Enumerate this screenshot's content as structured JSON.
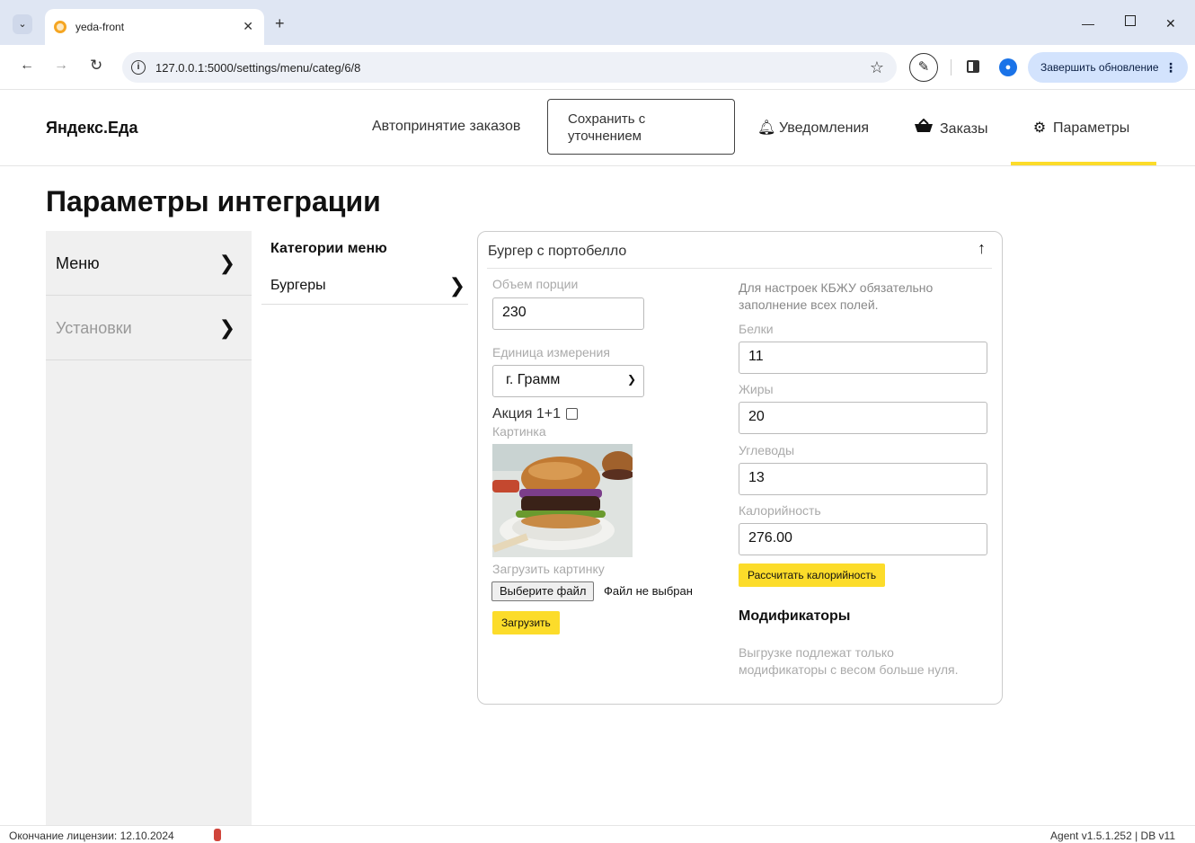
{
  "browser": {
    "tab_title": "yeda-front",
    "url": "127.0.0.1:5000/settings/menu/categ/6/8",
    "update_label": "Завершить обновление"
  },
  "header": {
    "logo": "Яндекс.Еда",
    "auto_accept": "Автопринятие заказов",
    "save_clarify_line1": "Сохранить с",
    "save_clarify_line2": "уточнением",
    "notifications": "Уведомления",
    "orders": "Заказы",
    "settings": "Параметры"
  },
  "page": {
    "title": "Параметры интеграции"
  },
  "sidebar": {
    "items": [
      {
        "label": "Меню"
      },
      {
        "label": "Установки"
      }
    ]
  },
  "categories": {
    "title": "Категории меню",
    "items": [
      {
        "label": "Бургеры"
      }
    ]
  },
  "product": {
    "title": "Бургер с портобелло",
    "portion_label": "Объем порции",
    "portion_value": "230",
    "unit_label": "Единица измерения",
    "unit_value": "г. Грамм",
    "promo_label": "Акция 1+1",
    "image_label": "Картинка",
    "upload_label": "Загрузить картинку",
    "choose_file": "Выберите файл",
    "no_file": "Файл не выбран",
    "upload_button": "Загрузить",
    "kbju_note_line1": "Для настроек КБЖУ обязательно",
    "kbju_note_line2": "заполнение всех полей.",
    "protein_label": "Белки",
    "protein_value": "11",
    "fat_label": "Жиры",
    "fat_value": "20",
    "carbs_label": "Углеводы",
    "carbs_value": "13",
    "calories_label": "Калорийность",
    "calories_value": "276.00",
    "calc_button": "Рассчитать калорийность",
    "modifiers_title": "Модификаторы",
    "modifiers_note_line1": "Выгрузке подлежат только",
    "modifiers_note_line2": "модификаторы с весом больше нуля."
  },
  "footer": {
    "license": "Окончание лицензии: 12.10.2024",
    "version": "Agent v1.5.1.252  |  DB v11"
  },
  "colors": {
    "accent": "#fcdc2a",
    "license_dot": "#d0453b"
  }
}
